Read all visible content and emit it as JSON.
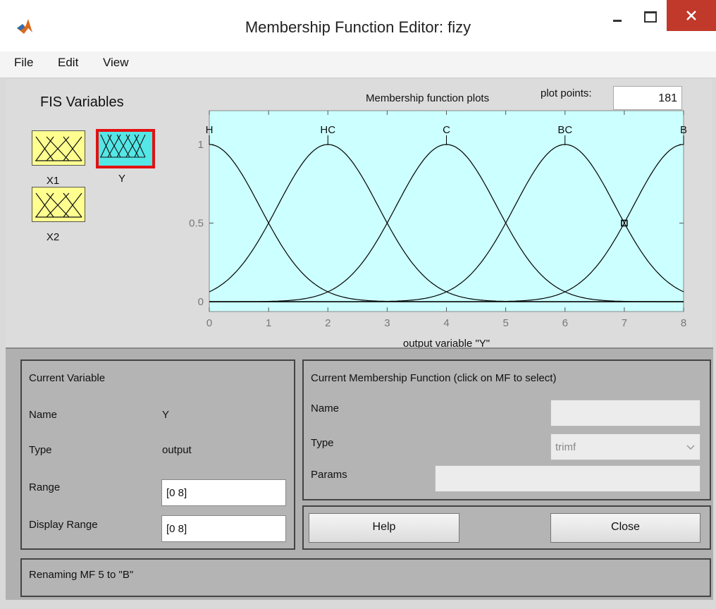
{
  "window": {
    "title": "Membership Function Editor: fizy"
  },
  "menu": [
    "File",
    "Edit",
    "View"
  ],
  "fis": {
    "title": "FIS Variables",
    "variables": [
      {
        "name": "X1",
        "kind": "input",
        "color": "#ffff90"
      },
      {
        "name": "Y",
        "kind": "output",
        "color": "#55e6e6",
        "selected": true
      },
      {
        "name": "X2",
        "kind": "input",
        "color": "#ffff90"
      }
    ]
  },
  "plot": {
    "title": "Membership function plots",
    "plot_points_label": "plot points:",
    "plot_points_value": "181",
    "background": "#ccffff"
  },
  "chart_data": {
    "type": "line",
    "xlabel": "output variable \"Y\"",
    "xlim": [
      0,
      8
    ],
    "ylim": [
      0,
      1
    ],
    "xticks": [
      "0",
      "1",
      "2",
      "3",
      "4",
      "5",
      "6",
      "7",
      "8"
    ],
    "yticks": [
      "0",
      "0.5",
      "1"
    ],
    "mf_labels": [
      "H",
      "HC",
      "C",
      "BC",
      "B"
    ],
    "series": [
      {
        "name": "H",
        "type": "gaussian",
        "center": 0,
        "sigma": 0.85
      },
      {
        "name": "HC",
        "type": "gaussian",
        "center": 2,
        "sigma": 0.85
      },
      {
        "name": "C",
        "type": "gaussian",
        "center": 4,
        "sigma": 0.85
      },
      {
        "name": "BC",
        "type": "gaussian",
        "center": 6,
        "sigma": 0.85
      },
      {
        "name": "B",
        "type": "gaussian",
        "center": 8,
        "sigma": 0.85
      }
    ],
    "marker": {
      "x": 7,
      "y": 0.5
    }
  },
  "current_variable": {
    "title": "Current Variable",
    "name_label": "Name",
    "name_value": "Y",
    "type_label": "Type",
    "type_value": "output",
    "range_label": "Range",
    "range_value": "[0 8]",
    "display_range_label": "Display Range",
    "display_range_value": "[0 8]"
  },
  "current_mf": {
    "title": "Current Membership Function (click on MF to select)",
    "name_label": "Name",
    "name_value": "",
    "type_label": "Type",
    "type_value": "trimf",
    "params_label": "Params",
    "params_value": ""
  },
  "buttons": {
    "help": "Help",
    "close": "Close"
  },
  "status": "Renaming MF 5 to \"B\""
}
